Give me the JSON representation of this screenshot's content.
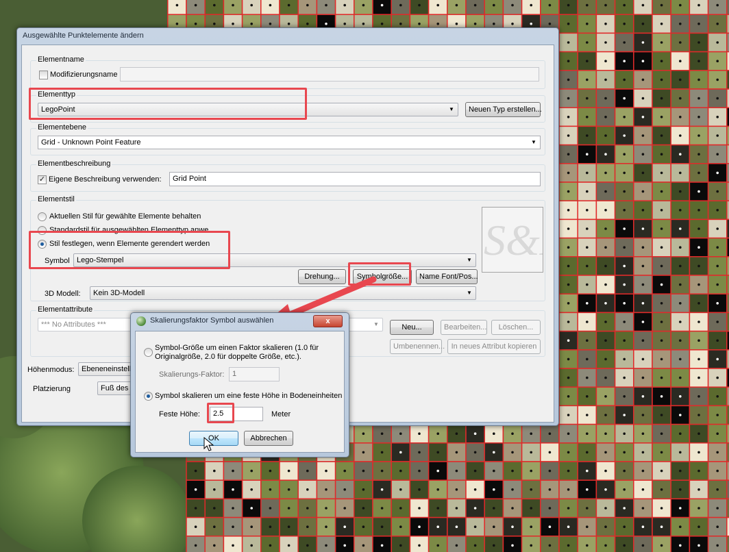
{
  "main_dialog": {
    "title": "Ausgewählte Punktelemente ändern",
    "elementname": {
      "group_label": "Elementname",
      "mod_checkbox_label": "Modifizierungsname",
      "mod_checked": false,
      "name_value": ""
    },
    "elementtyp": {
      "group_label": "Elementtyp",
      "selected": "LegoPoint",
      "new_type_button": "Neuen Typ erstellen..."
    },
    "elementebene": {
      "group_label": "Elementebene",
      "selected": "Grid - Unknown Point Feature"
    },
    "beschreibung": {
      "group_label": "Elementbeschreibung",
      "checkbox_label": "Eigene Beschreibung verwenden:",
      "checked": true,
      "value": "Grid Point"
    },
    "stil": {
      "group_label": "Elementstil",
      "radio_keep": "Aktuellen Stil für gewählte Elemente behalten",
      "radio_default": "Standardstil für ausgewählten Elementtyp anwe",
      "radio_set": "Stil festlegen, wenn Elemente gerendert werden",
      "selected_radio": "set",
      "symbol_label": "Symbol",
      "symbol_value": "Lego-Stempel",
      "rotation_button": "Drehung...",
      "symbol_size_button": "Symbolgröße...",
      "name_font_button": "Name Font/Pos...",
      "model_label": "3D Modell:",
      "model_value": "Kein 3D-Modell",
      "preview_text": "S&M"
    },
    "attribute": {
      "group_label": "Elementattribute",
      "selected": "*** No Attributes ***",
      "new_button": "Neu...",
      "edit_button": "Bearbeiten...",
      "delete_button": "Löschen...",
      "rename_button": "Umbenennen...",
      "copy_button": "In neues Attribut kopieren"
    },
    "hoehenmodus_label": "Höhenmodus:",
    "hoehenmodus_value": "Ebeneneinstellu",
    "platzierung_label": "Platzierung",
    "platzierung_value": "Fuß des N"
  },
  "scale_dialog": {
    "title": "Skalierungsfaktor Symbol auswählen",
    "close_label": "x",
    "option_factor": "Symbol-Größe um einen Faktor skalieren (1.0 für Originalgröße, 2.0 für doppelte Größe, etc.).",
    "factor_label": "Skalierungs-Faktor:",
    "factor_value": "1",
    "option_fixed": "Symbol skalieren um eine feste Höhe in Bodeneinheiten",
    "selected_option": "fixed",
    "height_label": "Feste Höhe:",
    "height_value": "2.5",
    "height_unit": "Meter",
    "ok_button": "OK",
    "cancel_button": "Abbrechen"
  },
  "colors": {
    "highlight": "#e8474f",
    "grid_line": "#e02a2a"
  }
}
